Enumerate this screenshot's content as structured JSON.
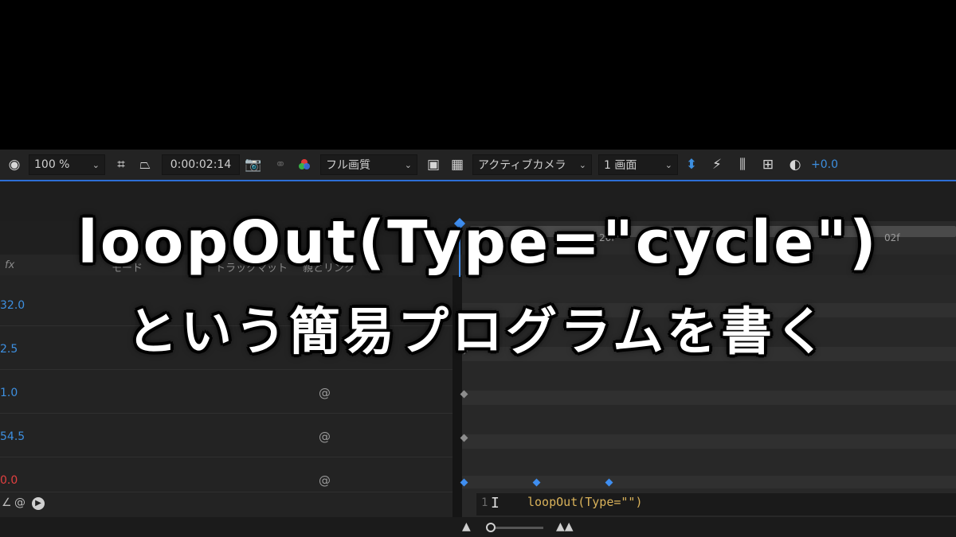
{
  "toolbar": {
    "zoom_value": "100 %",
    "timecode": "0:00:02:14",
    "quality": "フル画質",
    "camera": "アクティブカメラ",
    "views": "1 画面",
    "exposure": "+0.0",
    "icons": [
      "mask-icon",
      "region-icon",
      "transparency-grid-icon",
      "snapshot-icon",
      "show-snapshot-icon",
      "color-channels-icon",
      "toggle-mask-icon",
      "checkerboard-icon",
      "reset-exposure-icon",
      "fast-preview-icon",
      "timeline-icon",
      "flowchart-icon",
      "exposure-icon"
    ]
  },
  "timeline": {
    "ruler_ticks": [
      "20f",
      "02f"
    ],
    "column_headers": [
      "fx",
      "モード",
      "トラックマット",
      "親とリンク"
    ],
    "property_values": [
      {
        "text": "32.0",
        "color": "#3d8fe0"
      },
      {
        "text": "2.5",
        "color": "#3d8fe0"
      },
      {
        "text": "1.0",
        "color": "#3d8fe0"
      },
      {
        "text": "54.5",
        "color": "#3d8fe0"
      },
      {
        "text": "0.0",
        "color": "#e24040"
      }
    ]
  },
  "expression": {
    "line_number": "1",
    "code": "loopOut(Type=\"\")"
  },
  "overlay": {
    "line1": "loopOut(Type=\"cycle\")",
    "line2": "という簡易プログラムを書く"
  }
}
